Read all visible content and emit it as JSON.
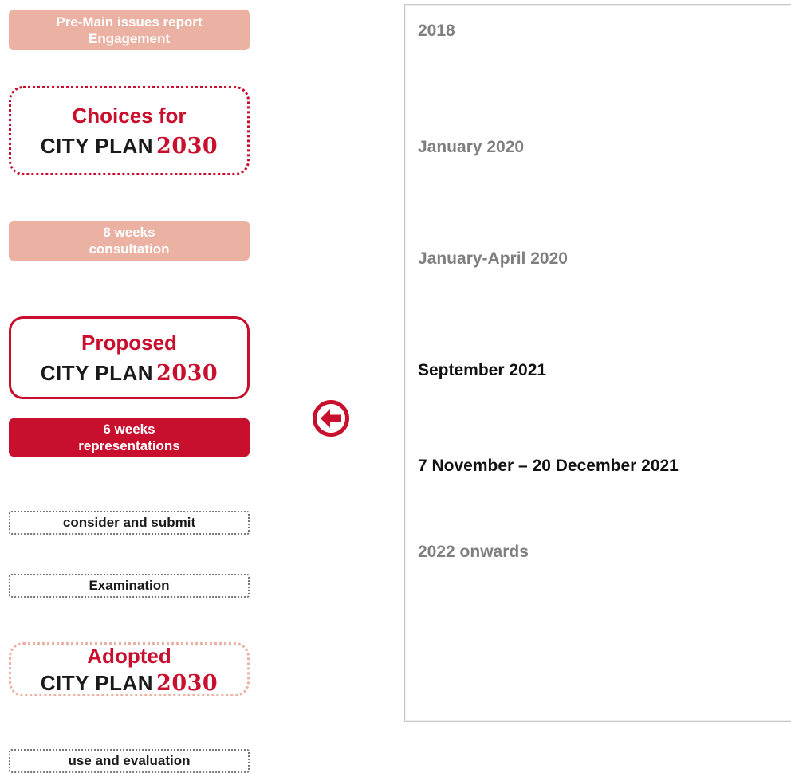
{
  "steps": [
    {
      "kind": "pill",
      "lines": [
        "Pre-Main issues report",
        "Engagement"
      ],
      "tone": "light"
    },
    {
      "kind": "plan",
      "word": "Choices for",
      "name": "CITY PLAN",
      "year": "2030",
      "style": "dotted-red"
    },
    {
      "kind": "pill",
      "lines": [
        "8 weeks",
        "consultation"
      ],
      "tone": "light"
    },
    {
      "kind": "plan",
      "word": "Proposed",
      "name": "CITY PLAN",
      "year": "2030",
      "style": "solid-red"
    },
    {
      "kind": "pill",
      "lines": [
        "6 weeks",
        "representations"
      ],
      "tone": "dark"
    },
    {
      "kind": "note",
      "text": "consider and submit"
    },
    {
      "kind": "note",
      "text": "Examination"
    },
    {
      "kind": "plan",
      "word": "Adopted",
      "name": "CITY PLAN",
      "year": "2030",
      "style": "dotted-peach"
    },
    {
      "kind": "note",
      "text": "use and evaluation"
    }
  ],
  "arrow": {
    "icon": "circle-arrow-left-icon",
    "color": "#c8102e"
  },
  "dates": [
    {
      "text": "2018",
      "tone": "muted"
    },
    {
      "text": "January 2020",
      "tone": "muted"
    },
    {
      "text": "January-April 2020",
      "tone": "muted"
    },
    {
      "text": "September 2021",
      "tone": "strong"
    },
    {
      "text": "7 November – 20 December 2021",
      "tone": "strong"
    },
    {
      "text": "2022 onwards",
      "tone": "muted"
    }
  ],
  "colors": {
    "brand_red": "#c8102e",
    "peach": "#ebb1a2",
    "muted_text": "#7f7f7f",
    "strong_text": "#111111"
  }
}
